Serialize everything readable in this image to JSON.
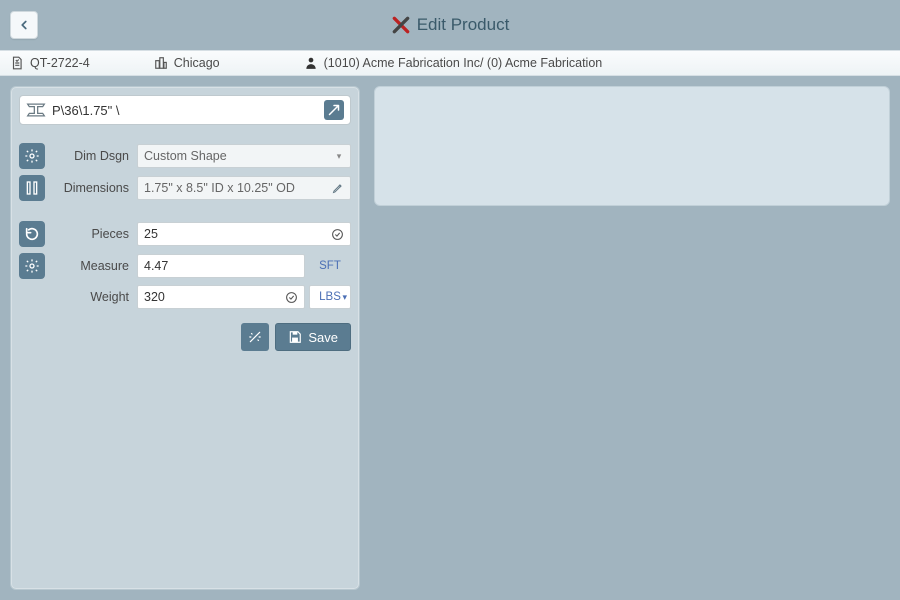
{
  "header": {
    "title": "Edit Product"
  },
  "infobar": {
    "doc_id": "QT-2722-4",
    "location": "Chicago",
    "customer": "(1010) Acme Fabrication Inc/ (0) Acme Fabrication"
  },
  "product": {
    "name": "P\\36\\1.75\" \\"
  },
  "form": {
    "dim_dsgn_label": "Dim Dsgn",
    "dim_dsgn_value": "Custom Shape",
    "dimensions_label": "Dimensions",
    "dimensions_value": "1.75\" x 8.5\" ID x 10.25\" OD",
    "pieces_label": "Pieces",
    "pieces_value": "25",
    "measure_label": "Measure",
    "measure_value": "4.47",
    "measure_unit": "SFT",
    "weight_label": "Weight",
    "weight_value": "320",
    "weight_unit": "LBS"
  },
  "buttons": {
    "save": "Save"
  }
}
